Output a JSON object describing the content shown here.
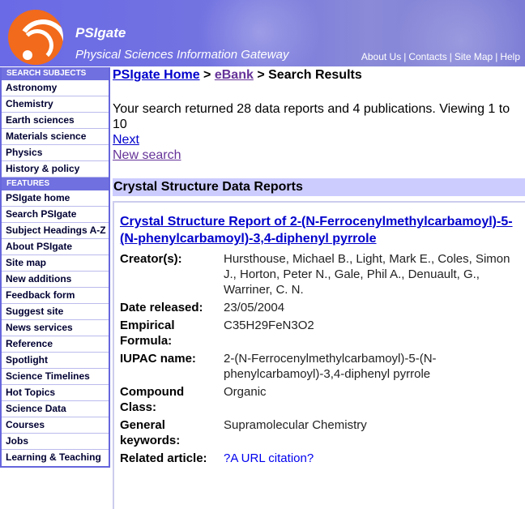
{
  "header": {
    "brand": "PSIgate",
    "tagline": "Physical Sciences Information Gateway",
    "top_links": [
      "About Us",
      "Contacts",
      "Site Map",
      "Help"
    ],
    "separator": "|"
  },
  "sidebar": {
    "subjects_heading": "SEARCH SUBJECTS",
    "subjects": [
      "Astronomy",
      "Chemistry",
      "Earth sciences",
      "Materials science",
      "Physics",
      "History & policy"
    ],
    "features_heading": "FEATURES",
    "features": [
      "PSIgate home",
      "Search PSIgate",
      "Subject Headings A-Z",
      "About PSIgate",
      "Site map",
      "New additions",
      "Feedback form",
      "Suggest site",
      "News services",
      "Reference",
      "Spotlight",
      "Science Timelines",
      "Hot Topics",
      "Science Data",
      "Courses",
      "Jobs",
      "Learning & Teaching"
    ]
  },
  "breadcrumb": {
    "home": "PSIgate Home",
    "ebank": "eBank",
    "current": "Search Results",
    "separator": ">"
  },
  "results": {
    "summary": "Your search returned 28 data reports and 4 publications. Viewing 1 to 10",
    "next_label": "Next",
    "new_search_label": "New search"
  },
  "section": {
    "heading": "Crystal Structure Data Reports"
  },
  "report": {
    "title": "Crystal Structure Report of 2-(N-Ferrocenylmethylcarbamoyl)-5-(N-phenylcarbamoyl)-3,4-diphenyl pyrrole",
    "fields": [
      {
        "label": "Creator(s):",
        "value": "Hursthouse, Michael B., Light, Mark E., Coles, Simon J., Horton, Peter N., Gale, Phil A., Denuault, G., Warriner, C. N."
      },
      {
        "label": "Date released:",
        "value": "23/05/2004"
      },
      {
        "label": "Empirical Formula:",
        "value": "C35H29FeN3O2"
      },
      {
        "label": "IUPAC name:",
        "value": "2-(N-Ferrocenylmethylcarbamoyl)-5-(N-phenylcarbamoyl)-3,4-diphenyl pyrrole"
      },
      {
        "label": "Compound Class:",
        "value": "Organic"
      },
      {
        "label": "General keywords:",
        "value": "Supramolecular Chemistry"
      },
      {
        "label": "Related article:",
        "value": "?A URL citation?"
      }
    ]
  }
}
